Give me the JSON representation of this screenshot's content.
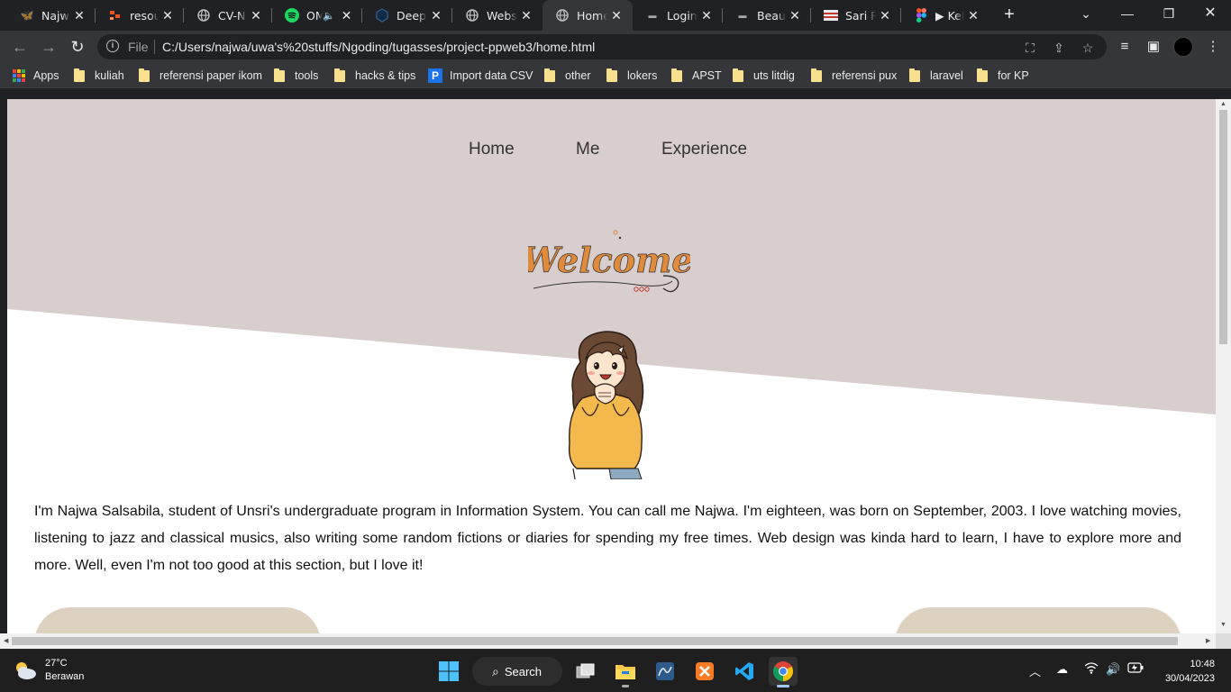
{
  "browser": {
    "tabs": [
      {
        "title": "Najwa",
        "active": false
      },
      {
        "title": "resources",
        "active": false
      },
      {
        "title": "CV-Najwa",
        "active": false
      },
      {
        "title": "OMG",
        "active": false
      },
      {
        "title": "DeepL",
        "active": false
      },
      {
        "title": "Website",
        "active": false
      },
      {
        "title": "Home",
        "active": true
      },
      {
        "title": "Login",
        "active": false
      },
      {
        "title": "Beauty",
        "active": false
      },
      {
        "title": "Sari Roti",
        "active": false
      },
      {
        "title": "▶ Kelompok",
        "active": false
      }
    ],
    "omnibox": {
      "scheme_label": "File",
      "url": "C:/Users/najwa/uwa's%20stuffs/Ngoding/tugasses/project-ppweb3/home.html"
    },
    "bookmarks": [
      {
        "label": "Apps",
        "type": "apps"
      },
      {
        "label": "kuliah",
        "type": "folder"
      },
      {
        "label": "referensi paper ikom",
        "type": "folder"
      },
      {
        "label": "tools",
        "type": "folder"
      },
      {
        "label": "hacks & tips",
        "type": "folder"
      },
      {
        "label": "Import data CSV",
        "type": "site"
      },
      {
        "label": "other",
        "type": "folder"
      },
      {
        "label": "lokers",
        "type": "folder"
      },
      {
        "label": "APST",
        "type": "folder"
      },
      {
        "label": "uts litdig",
        "type": "folder"
      },
      {
        "label": "referensi pux",
        "type": "folder"
      },
      {
        "label": "laravel",
        "type": "folder"
      },
      {
        "label": "for KP",
        "type": "folder"
      }
    ]
  },
  "page": {
    "nav": [
      "Home",
      "Me",
      "Experience"
    ],
    "welcome_text": "Welcome",
    "bio": "I'm Najwa Salsabila, student of Unsri's undergraduate program in Information System. You can call me Najwa. I'm eighteen, was born on September, 2003. I love watching movies, listening to jazz and classical musics, also writing some random fictions or diaries for spending my free times. Web design was kinda hard to learn, I have to explore more and more. Well, even I'm not too good at this section, but I love it!",
    "colors": {
      "hero": "#d8cece",
      "card": "#ddd1c0",
      "welcome": "#e08a3c"
    }
  },
  "taskbar": {
    "weather_temp": "27°C",
    "weather_cond": "Berawan",
    "search_label": "Search",
    "time": "10:48",
    "date": "30/04/2023"
  }
}
